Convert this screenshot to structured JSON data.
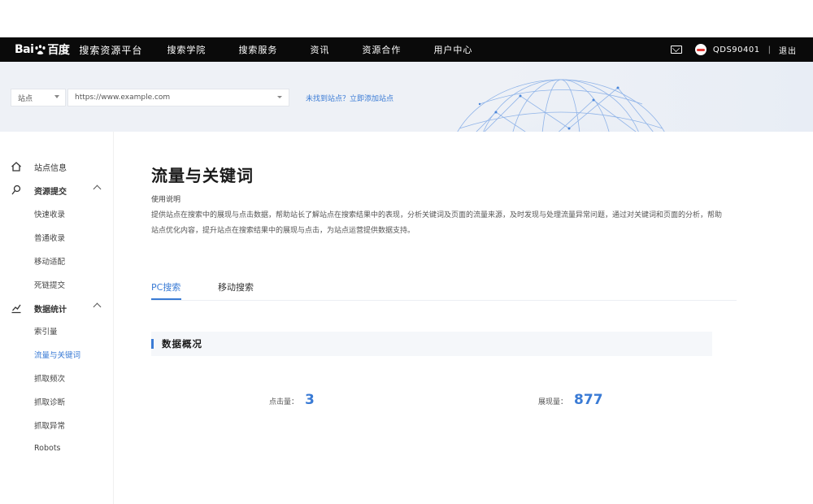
{
  "header": {
    "logo_left": "Bai",
    "logo_right": "百度",
    "platform": "搜索资源平台",
    "nav": [
      "搜索学院",
      "搜索服务",
      "资讯",
      "资源合作",
      "用户中心"
    ],
    "username": "QDS90401",
    "logout": "退出"
  },
  "banner": {
    "site_type": "站点",
    "site_url": "https://www.example.com",
    "add_site_link": "未找到站点？立即添加站点"
  },
  "sidebar": {
    "items": [
      {
        "label": "站点信息",
        "icon": "home-icon",
        "level": 0
      },
      {
        "label": "资源提交",
        "icon": "pin-icon",
        "level": 0,
        "expanded": true
      },
      {
        "label": "快速收录",
        "level": 1
      },
      {
        "label": "普通收录",
        "level": 1
      },
      {
        "label": "移动适配",
        "level": 1
      },
      {
        "label": "死链提交",
        "level": 1
      },
      {
        "label": "数据统计",
        "icon": "chart-icon",
        "level": 0,
        "expanded": true
      },
      {
        "label": "索引量",
        "level": 1
      },
      {
        "label": "流量与关键词",
        "level": 1,
        "active": true
      },
      {
        "label": "抓取频次",
        "level": 1
      },
      {
        "label": "抓取诊断",
        "level": 1
      },
      {
        "label": "抓取异常",
        "level": 1
      },
      {
        "label": "Robots",
        "level": 1
      }
    ]
  },
  "main": {
    "title": "流量与关键词",
    "desc_heading": "使用说明",
    "desc_text": "提供站点在搜索中的展现与点击数据，帮助站长了解站点在搜索结果中的表现，分析关键词及页面的流量来源，及时发现与处理流量异常问题，通过对关键词和页面的分析，帮助站点优化内容，提升站点在搜索结果中的展现与点击，为站点运营提供数据支持。",
    "tabs": [
      {
        "label": "PC搜索",
        "active": true
      },
      {
        "label": "移动搜索",
        "active": false
      }
    ],
    "section_title": "数据概况",
    "metrics": [
      {
        "label": "点击量",
        "value": "3"
      },
      {
        "label": "展现量",
        "value": "877"
      }
    ]
  },
  "colors": {
    "accent": "#3a7bd5",
    "topbar": "#0a0a0a",
    "banner": "#eef1f6"
  }
}
